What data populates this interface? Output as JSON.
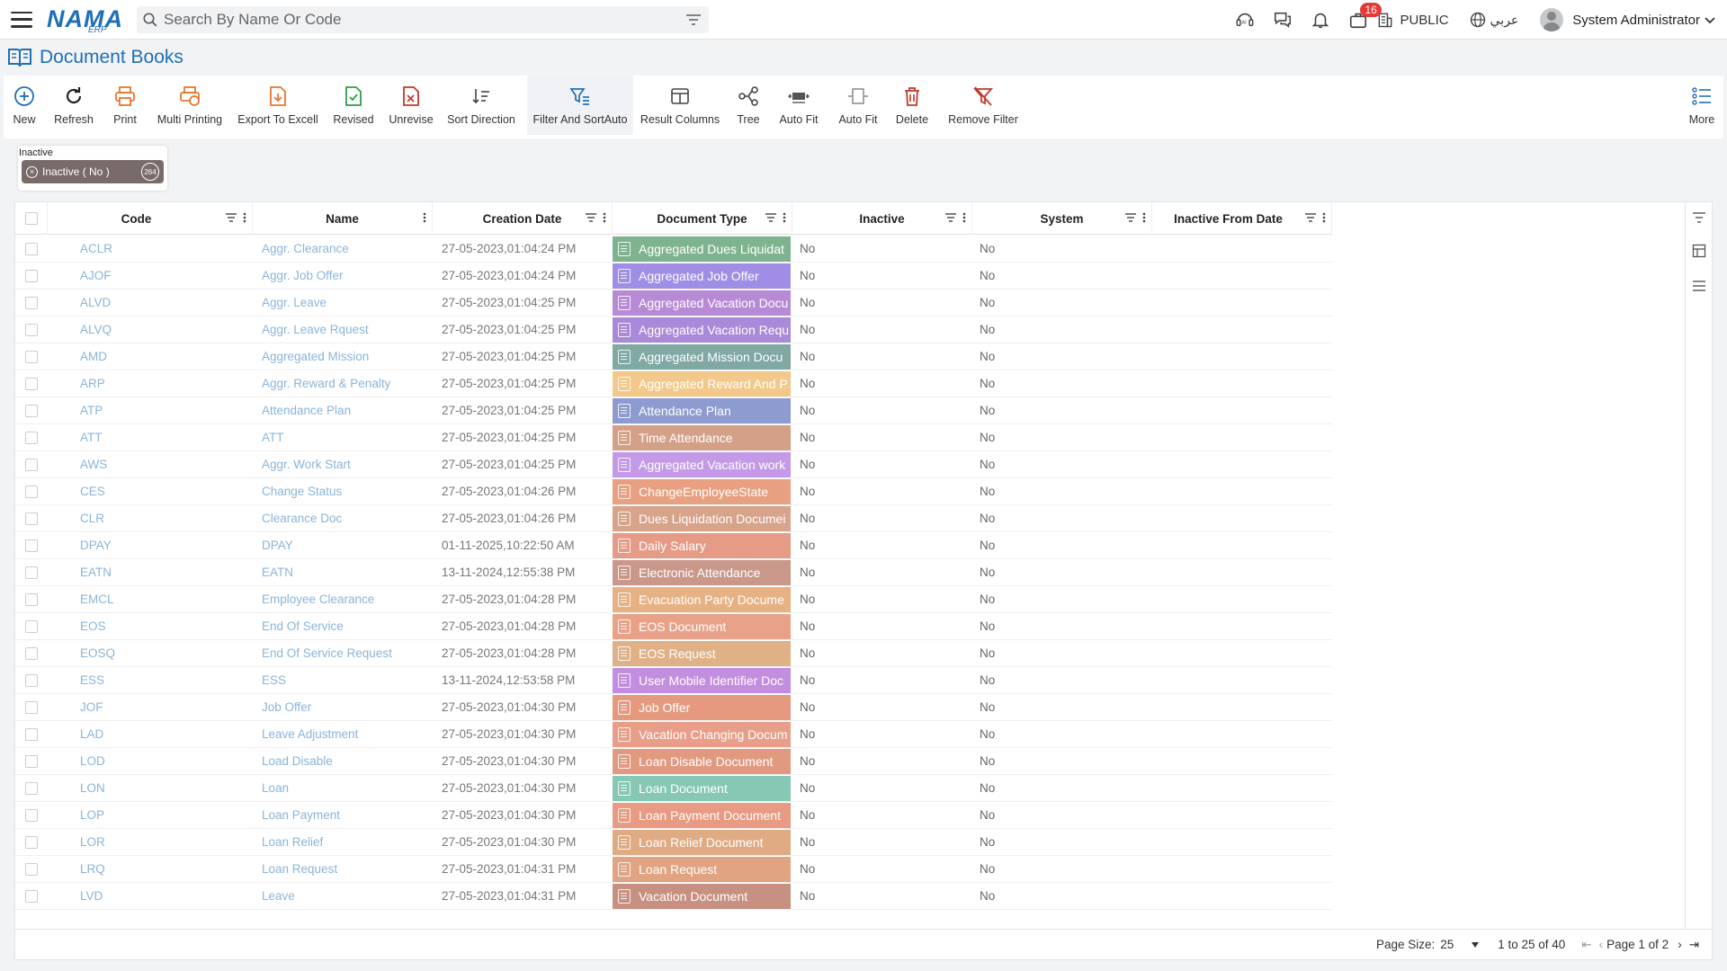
{
  "search": {
    "placeholder": "Search By Name Or Code"
  },
  "topbar": {
    "badge_count": "16",
    "public_label": "PUBLIC",
    "lang_label": "عربي",
    "user_name": "System Administrator"
  },
  "page": {
    "title": "Document Books"
  },
  "toolbar": {
    "new": "New",
    "refresh": "Refresh",
    "print": "Print",
    "multi_printing": "Multi Printing",
    "export": "Export To Excell",
    "revised": "Revised",
    "unrevise": "Unrevise",
    "sort_direction": "Sort Direction",
    "filter_sort": "Filter And SortAuto",
    "result_columns": "Result Columns",
    "tree": "Tree",
    "auto_fit1": "Auto Fit",
    "auto_fit2": "Auto Fit",
    "delete": "Delete",
    "remove_filter": "Remove Filter",
    "more": "More"
  },
  "filter_chip": {
    "title": "Inactive",
    "label": "Inactive ( No )",
    "count": "264"
  },
  "columns": {
    "code": "Code",
    "name": "Name",
    "creation_date": "Creation Date",
    "document_type": "Document Type",
    "inactive": "Inactive",
    "system": "System",
    "inactive_from_date": "Inactive From Date"
  },
  "rows": [
    {
      "code": "ACLR",
      "name": "Aggr. Clearance",
      "date": "27-05-2023,01:04:24 PM",
      "doc": "Aggregated Dues Liquidat",
      "color": "#7fb38f",
      "inactive": "No",
      "system": "No"
    },
    {
      "code": "AJOF",
      "name": "Aggr. Job Offer",
      "date": "27-05-2023,01:04:24 PM",
      "doc": "Aggregated Job Offer",
      "color": "#a08ee6",
      "inactive": "No",
      "system": "No"
    },
    {
      "code": "ALVD",
      "name": "Aggr. Leave",
      "date": "27-05-2023,01:04:25 PM",
      "doc": "Aggregated Vacation Docu",
      "color": "#b78ad6",
      "inactive": "No",
      "system": "No"
    },
    {
      "code": "ALVQ",
      "name": "Aggr. Leave Rquest",
      "date": "27-05-2023,01:04:25 PM",
      "doc": "Aggregated Vacation Requ",
      "color": "#a98ad8",
      "inactive": "No",
      "system": "No"
    },
    {
      "code": "AMD",
      "name": "Aggregated Mission",
      "date": "27-05-2023,01:04:25 PM",
      "doc": "Aggregated Mission Docu",
      "color": "#7fa9a2",
      "inactive": "No",
      "system": "No"
    },
    {
      "code": "ARP",
      "name": "Aggr. Reward & Penalty",
      "date": "27-05-2023,01:04:25 PM",
      "doc": "Aggregated Reward And P",
      "color": "#f2c98a",
      "inactive": "No",
      "system": "No"
    },
    {
      "code": "ATP",
      "name": "Attendance Plan",
      "date": "27-05-2023,01:04:25 PM",
      "doc": "Attendance Plan",
      "color": "#8e9bd0",
      "inactive": "No",
      "system": "No"
    },
    {
      "code": "ATT",
      "name": "ATT",
      "date": "27-05-2023,01:04:25 PM",
      "doc": "Time Attendance",
      "color": "#d5a088",
      "inactive": "No",
      "system": "No"
    },
    {
      "code": "AWS",
      "name": "Aggr. Work Start",
      "date": "27-05-2023,01:04:25 PM",
      "doc": "Aggregated Vacation work",
      "color": "#c49ae8",
      "inactive": "No",
      "system": "No"
    },
    {
      "code": "CES",
      "name": "Change Status",
      "date": "27-05-2023,01:04:26 PM",
      "doc": "ChangeEmployeeState",
      "color": "#e8a080",
      "inactive": "No",
      "system": "No"
    },
    {
      "code": "CLR",
      "name": "Clearance Doc",
      "date": "27-05-2023,01:04:26 PM",
      "doc": "Dues Liquidation Documei",
      "color": "#d7a38a",
      "inactive": "No",
      "system": "No"
    },
    {
      "code": "DPAY",
      "name": "DPAY",
      "date": "01-11-2025,10:22:50 AM",
      "doc": "Daily Salary",
      "color": "#e59b86",
      "inactive": "No",
      "system": "No"
    },
    {
      "code": "EATN",
      "name": "EATN",
      "date": "13-11-2024,12:55:38 PM",
      "doc": "Electronic Attendance",
      "color": "#c9988a",
      "inactive": "No",
      "system": "No"
    },
    {
      "code": "EMCL",
      "name": "Employee Clearance",
      "date": "27-05-2023,01:04:28 PM",
      "doc": "Evacuation Party Docume",
      "color": "#e7b283",
      "inactive": "No",
      "system": "No"
    },
    {
      "code": "EOS",
      "name": "End Of Service",
      "date": "27-05-2023,01:04:28 PM",
      "doc": "EOS Document",
      "color": "#e9a28a",
      "inactive": "No",
      "system": "No"
    },
    {
      "code": "EOSQ",
      "name": "End Of Service Request",
      "date": "27-05-2023,01:04:28 PM",
      "doc": "EOS Request",
      "color": "#e0b187",
      "inactive": "No",
      "system": "No"
    },
    {
      "code": "ESS",
      "name": "ESS",
      "date": "13-11-2024,12:53:58 PM",
      "doc": "User Mobile Identifier Doc",
      "color": "#c48ee0",
      "inactive": "No",
      "system": "No"
    },
    {
      "code": "JOF",
      "name": "Job Offer",
      "date": "27-05-2023,01:04:30 PM",
      "doc": "Job Offer",
      "color": "#e59a80",
      "inactive": "No",
      "system": "No"
    },
    {
      "code": "LAD",
      "name": "Leave Adjustment",
      "date": "27-05-2023,01:04:30 PM",
      "doc": "Vacation Changing Docum",
      "color": "#e89e88",
      "inactive": "No",
      "system": "No"
    },
    {
      "code": "LOD",
      "name": "Load Disable",
      "date": "27-05-2023,01:04:30 PM",
      "doc": "Loan Disable Document",
      "color": "#e19a80",
      "inactive": "No",
      "system": "No"
    },
    {
      "code": "LON",
      "name": "Loan",
      "date": "27-05-2023,01:04:30 PM",
      "doc": "Loan Document",
      "color": "#87c8b5",
      "inactive": "No",
      "system": "No"
    },
    {
      "code": "LOP",
      "name": "Loan Payment",
      "date": "27-05-2023,01:04:30 PM",
      "doc": "Loan Payment Document",
      "color": "#e89a82",
      "inactive": "No",
      "system": "No"
    },
    {
      "code": "LOR",
      "name": "Loan Relief",
      "date": "27-05-2023,01:04:30 PM",
      "doc": "Loan Relief Document",
      "color": "#e0ab83",
      "inactive": "No",
      "system": "No"
    },
    {
      "code": "LRQ",
      "name": "Loan Request",
      "date": "27-05-2023,01:04:31 PM",
      "doc": "Loan Request",
      "color": "#e0a482",
      "inactive": "No",
      "system": "No"
    },
    {
      "code": "LVD",
      "name": "Leave",
      "date": "27-05-2023,01:04:31 PM",
      "doc": "Vacation Document",
      "color": "#c89080",
      "inactive": "No",
      "system": "No"
    }
  ],
  "footer": {
    "page_size_label": "Page Size:",
    "page_size": "25",
    "range": "1 to 25 of 40",
    "page_info": "Page 1 of 2"
  },
  "colors": {
    "brand": "#1f6fb8",
    "link": "#8ab4d8"
  }
}
